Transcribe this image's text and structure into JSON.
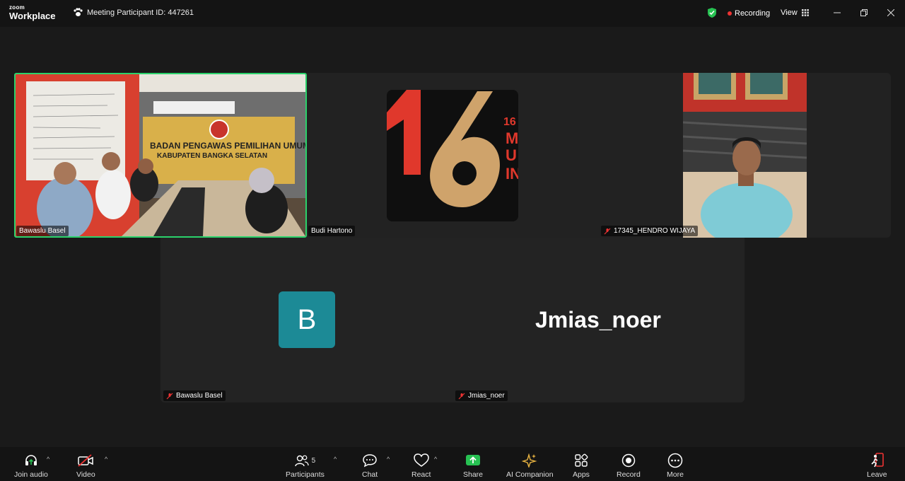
{
  "app": {
    "logo_line1": "zoom",
    "logo_line2": "Workplace"
  },
  "titlebar": {
    "meeting_id": "Meeting Participant ID: 447261",
    "recording": "Recording",
    "view": "View",
    "minimize_icon": "minimize-icon",
    "restore_icon": "restore-icon",
    "close_icon": "close-icon"
  },
  "participants": {
    "camera_name": "Bawaslu Basel",
    "budi": "Budi Hartono",
    "hendro": "17345_HENDRO WIJAYA",
    "bawaslu": "Bawaslu Basel",
    "jmias": "Jmias_noer",
    "avatar_letter": "B",
    "big_name": "Jmias_noer"
  },
  "camera_scene": {
    "banner_line1": "BADAN PENGAWAS PEMILIHAN UMUM",
    "banner_line2": "KABUPATEN BANGKA SELATAN"
  },
  "logo_tile": {
    "number": "16",
    "side_text": [
      "16",
      "M",
      "U",
      "IN"
    ]
  },
  "toolbar": {
    "join_audio": "Join audio",
    "video": "Video",
    "participants": "Participants",
    "participants_count": "5",
    "chat": "Chat",
    "react": "React",
    "share": "Share",
    "ai_companion": "AI Companion",
    "apps": "Apps",
    "record": "Record",
    "more": "More",
    "leave": "Leave"
  },
  "colors": {
    "active_speaker_border": "#2bd26b",
    "share_green": "#27c152",
    "recording_red": "#e33333",
    "avatar_teal": "#1c8a96",
    "ai_gold": "#e8b341"
  }
}
